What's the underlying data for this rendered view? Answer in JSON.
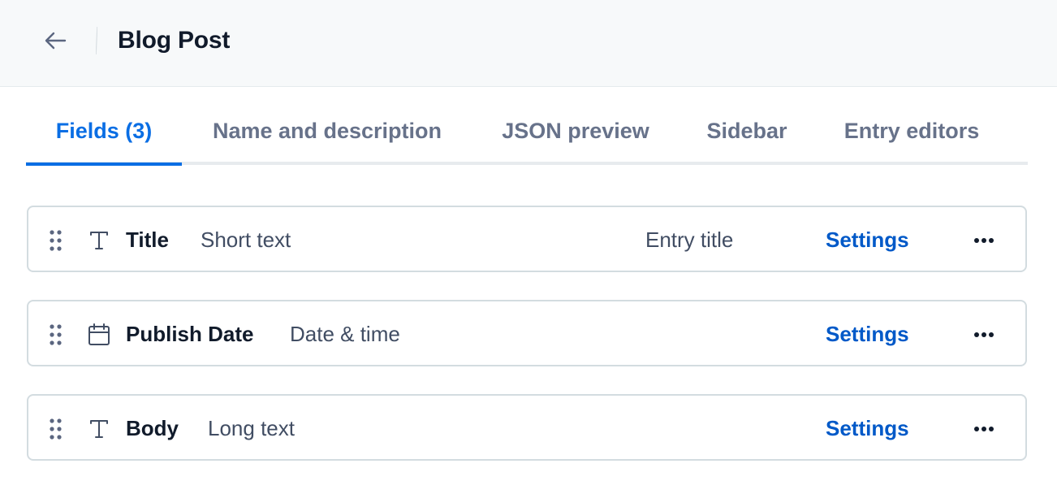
{
  "header": {
    "back_icon": "arrow-left-icon",
    "title": "Blog Post"
  },
  "tabs": [
    {
      "label": "Fields (3)",
      "active": true
    },
    {
      "label": "Name and description",
      "active": false
    },
    {
      "label": "JSON preview",
      "active": false
    },
    {
      "label": "Sidebar",
      "active": false
    },
    {
      "label": "Entry editors",
      "active": false
    }
  ],
  "fields": [
    {
      "name": "Title",
      "type": "Short text",
      "icon": "text-icon",
      "badge": "Entry title",
      "settings_label": "Settings"
    },
    {
      "name": "Publish Date",
      "type": "Date & time",
      "icon": "calendar-icon",
      "badge": "",
      "settings_label": "Settings"
    },
    {
      "name": "Body",
      "type": "Long text",
      "icon": "text-icon",
      "badge": "",
      "settings_label": "Settings"
    }
  ],
  "colors": {
    "accent": "#0a6ee4",
    "link": "#0059c8",
    "muted_tab": "#67728a",
    "text": "#111b2b",
    "header_bg": "#f7f9fa",
    "border": "#d3dce0"
  }
}
